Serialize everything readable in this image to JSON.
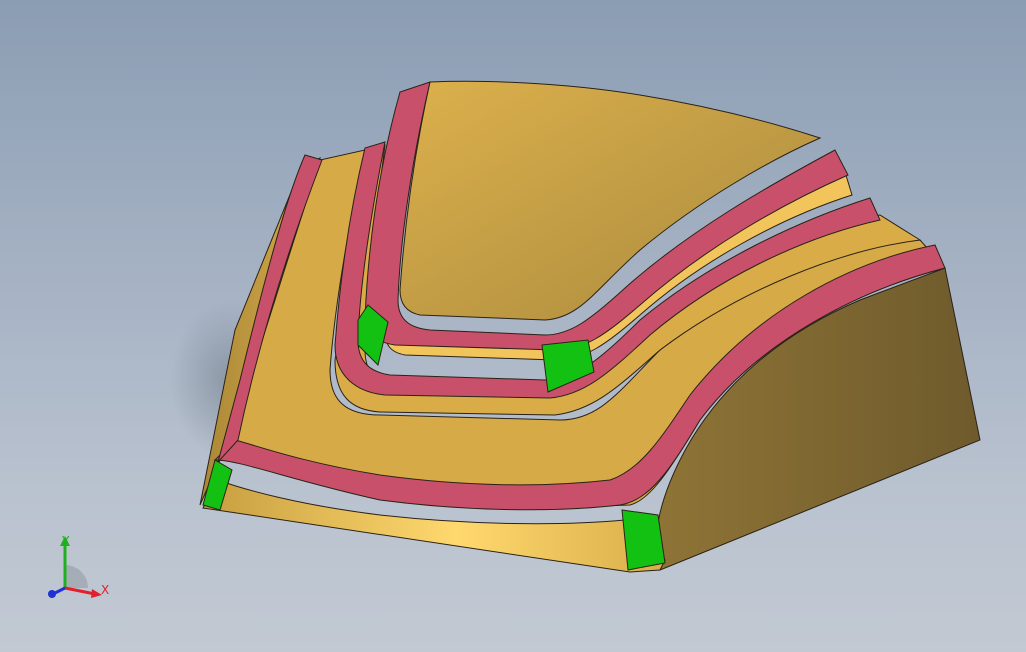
{
  "viewport": {
    "background_top": "#8b9db3",
    "background_bottom": "#c2c9d3"
  },
  "model": {
    "description_name": "stepped-block-part",
    "colors": {
      "body": "#d9ac48",
      "body_shade": "#b8903a",
      "side_dark": "#8c7038",
      "fillet_red": "#c9506a",
      "fillet_green": "#12c112",
      "edge": "#2a2218"
    }
  },
  "triad": {
    "x_label": "X",
    "y_label": "Y",
    "colors": {
      "x": "#e0202a",
      "y": "#1eb01e",
      "z": "#1f2fd8"
    }
  }
}
